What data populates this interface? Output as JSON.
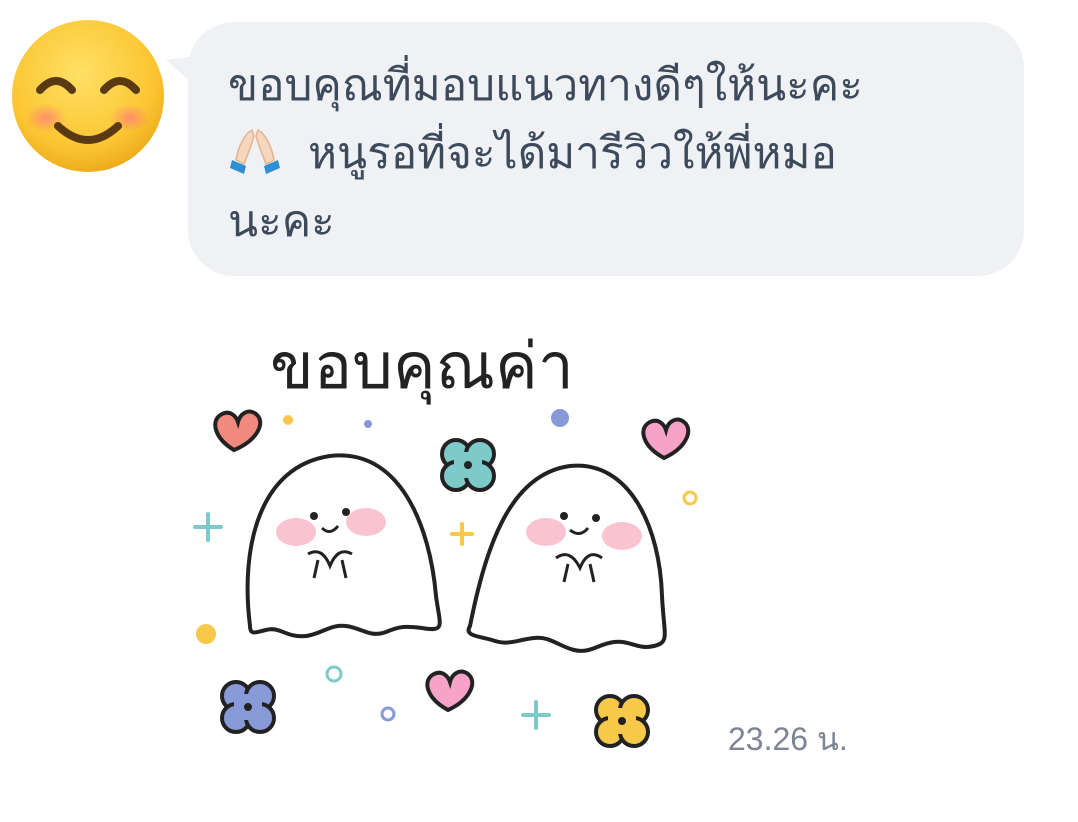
{
  "message": {
    "line1": "ขอบคุณที่มอบแนวทางดีๆให้นะคะ",
    "line2": "หนูรอที่จะได้มารีวิวให้พี่หมอ",
    "line3": "นะคะ",
    "emoji": "folded-hands"
  },
  "sticker": {
    "caption": "ขอบคุณค่า",
    "icon": "thank-you-ghosts-sticker"
  },
  "timestamp": "23.26 น.",
  "avatar": {
    "icon": "smiling-face-emoji"
  },
  "colors": {
    "bubble_bg": "#eff1f4",
    "bubble_text": "#3d4a5c",
    "timestamp": "#7c8594"
  }
}
